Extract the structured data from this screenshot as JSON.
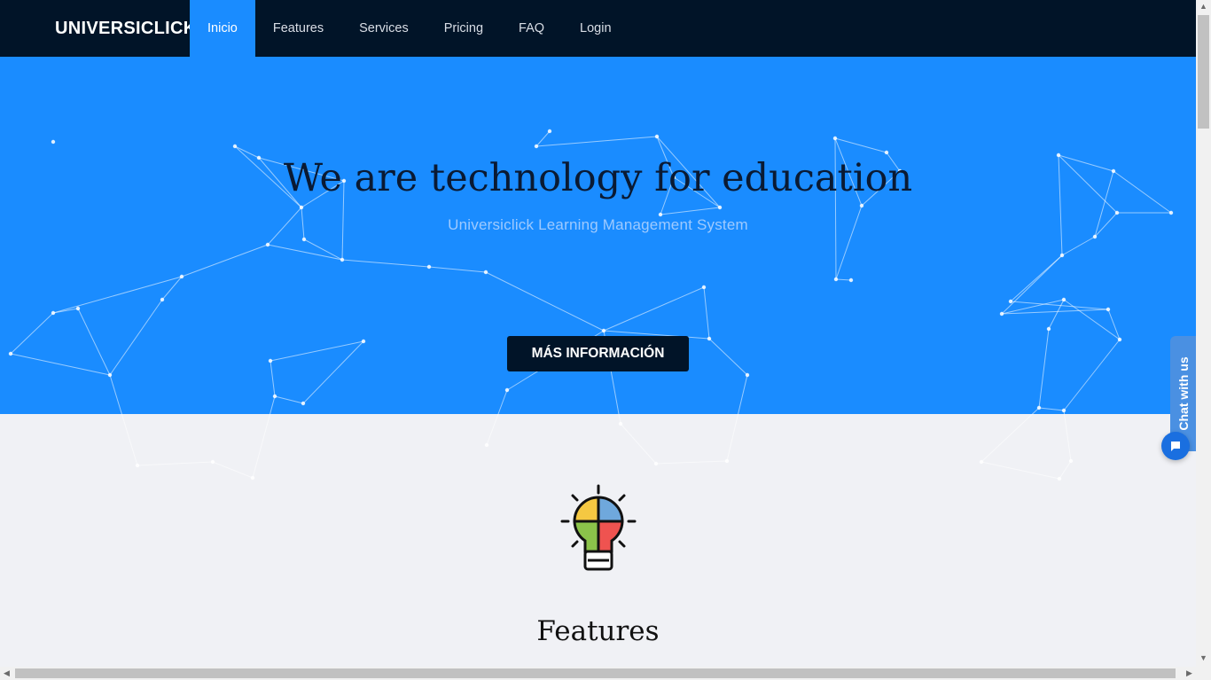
{
  "brand": {
    "name": "UNIVERSICLICK",
    "logo_icon": "universiclick-logo-icon"
  },
  "nav": {
    "items": [
      {
        "label": "Inicio",
        "active": true
      },
      {
        "label": "Features",
        "active": false
      },
      {
        "label": "Services",
        "active": false
      },
      {
        "label": "Pricing",
        "active": false
      },
      {
        "label": "FAQ",
        "active": false
      },
      {
        "label": "Login",
        "active": false
      }
    ]
  },
  "hero": {
    "title": "We are technology for education",
    "subtitle": "Universiclick Learning Management System",
    "cta_label": "MÁS INFORMACIÓN",
    "background_color": "#1a8cff"
  },
  "features": {
    "icon": "lightbulb-puzzle-icon",
    "title": "Features"
  },
  "chat": {
    "tab_label": "Chat with us",
    "bubble_icon": "chat-bubble-icon"
  },
  "colors": {
    "navbar": "#011428",
    "accent": "#1a8cff",
    "button": "#011428",
    "page_background": "#f0f1f5"
  }
}
